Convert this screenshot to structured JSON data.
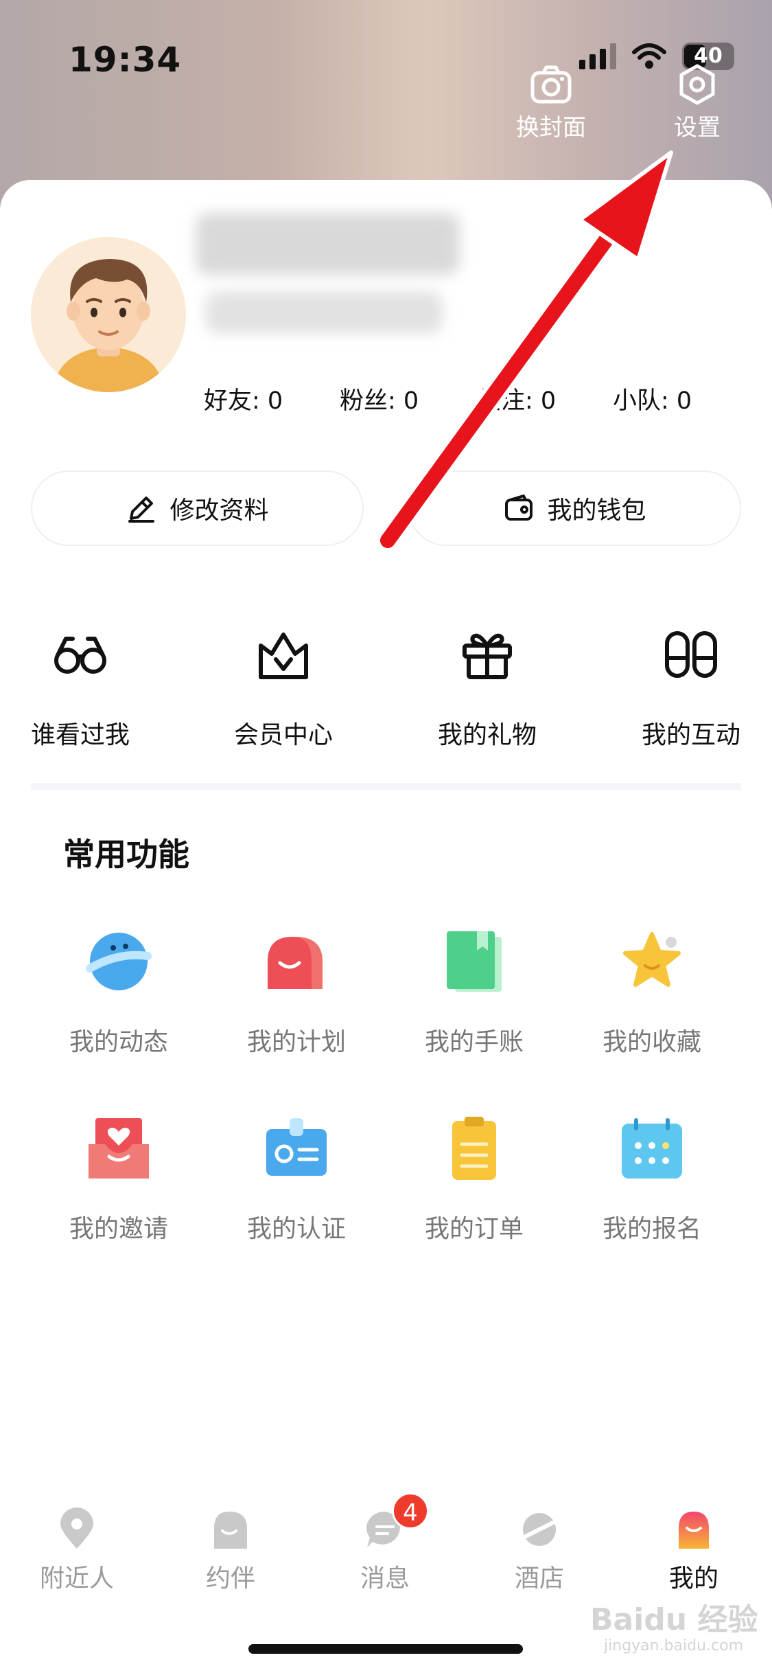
{
  "status_bar": {
    "time": "19:34",
    "battery": "40"
  },
  "header": {
    "change_cover_label": "换封面",
    "settings_label": "设置"
  },
  "profile": {
    "stats": [
      {
        "label": "好友: 0"
      },
      {
        "label": "粉丝: 0"
      },
      {
        "label": "关注: 0"
      },
      {
        "label": "小队: 0"
      }
    ],
    "edit_profile_label": "修改资料",
    "wallet_label": "我的钱包"
  },
  "quick_actions": [
    {
      "label": "谁看过我",
      "icon": "glasses-icon"
    },
    {
      "label": "会员中心",
      "icon": "crown-icon"
    },
    {
      "label": "我的礼物",
      "icon": "gift-icon"
    },
    {
      "label": "我的互动",
      "icon": "footprints-icon"
    }
  ],
  "common_functions": {
    "title": "常用功能",
    "items": [
      {
        "label": "我的动态",
        "icon": "planet-icon"
      },
      {
        "label": "我的计划",
        "icon": "chat-bubbles-icon"
      },
      {
        "label": "我的手账",
        "icon": "notebook-icon"
      },
      {
        "label": "我的收藏",
        "icon": "star-icon"
      },
      {
        "label": "我的邀请",
        "icon": "invite-envelope-icon"
      },
      {
        "label": "我的认证",
        "icon": "id-badge-icon"
      },
      {
        "label": "我的订单",
        "icon": "clipboard-icon"
      },
      {
        "label": "我的报名",
        "icon": "calendar-icon"
      }
    ]
  },
  "tab_bar": {
    "tabs": [
      {
        "label": "附近人",
        "icon": "location-pin-icon"
      },
      {
        "label": "约伴",
        "icon": "companion-icon"
      },
      {
        "label": "消息",
        "icon": "message-icon",
        "badge": "4"
      },
      {
        "label": "酒店",
        "icon": "hotel-planet-icon"
      },
      {
        "label": "我的",
        "icon": "profile-icon"
      }
    ],
    "active_index": 4
  },
  "watermark": {
    "brand": "Baidu 经验",
    "url": "jingyan.baidu.com"
  },
  "colors": {
    "accent_red": "#ef3b2c",
    "annotation_arrow": "#e8141c",
    "text_primary": "#111111",
    "text_secondary": "#777777"
  }
}
